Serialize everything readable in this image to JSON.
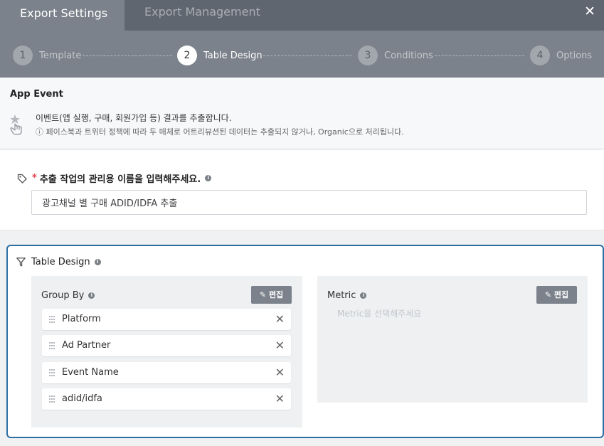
{
  "tabs": {
    "active": "Export Settings",
    "inactive": "Export Management",
    "close": "✕"
  },
  "stepper": {
    "steps": [
      {
        "num": "1",
        "label": "Template"
      },
      {
        "num": "2",
        "label": "Table Design"
      },
      {
        "num": "3",
        "label": "Conditions"
      },
      {
        "num": "4",
        "label": "Options"
      }
    ],
    "active_index": 2
  },
  "event": {
    "title": "App Event",
    "description": "이벤트(앱 실행, 구매, 회원가입 등) 결과를 추출합니다.",
    "note": "ⓘ 페이스북과 트위터 정책에 따라 두 매체로 어트리뷰션된 데이터는 추출되지 않거나, Organic으로 처리됩니다."
  },
  "name_field": {
    "required_mark": "*",
    "label": "추출 작업의 관리용 이름을 입력해주세요.",
    "value": "광고채널 별 구매 ADID/IDFA 추출"
  },
  "table_design": {
    "title": "Table Design",
    "group_by": {
      "title": "Group By",
      "edit_label": "편집",
      "items": [
        "Platform",
        "Ad Partner",
        "Event Name",
        "adid/idfa"
      ]
    },
    "metric": {
      "title": "Metric",
      "edit_label": "편집",
      "placeholder": "Metric을 선택해주세요"
    }
  },
  "colors": {
    "accent_border": "#2c6fa3",
    "header_bg": "#5f6670",
    "stepper_bg": "#7b828b",
    "required": "#e5484d"
  }
}
